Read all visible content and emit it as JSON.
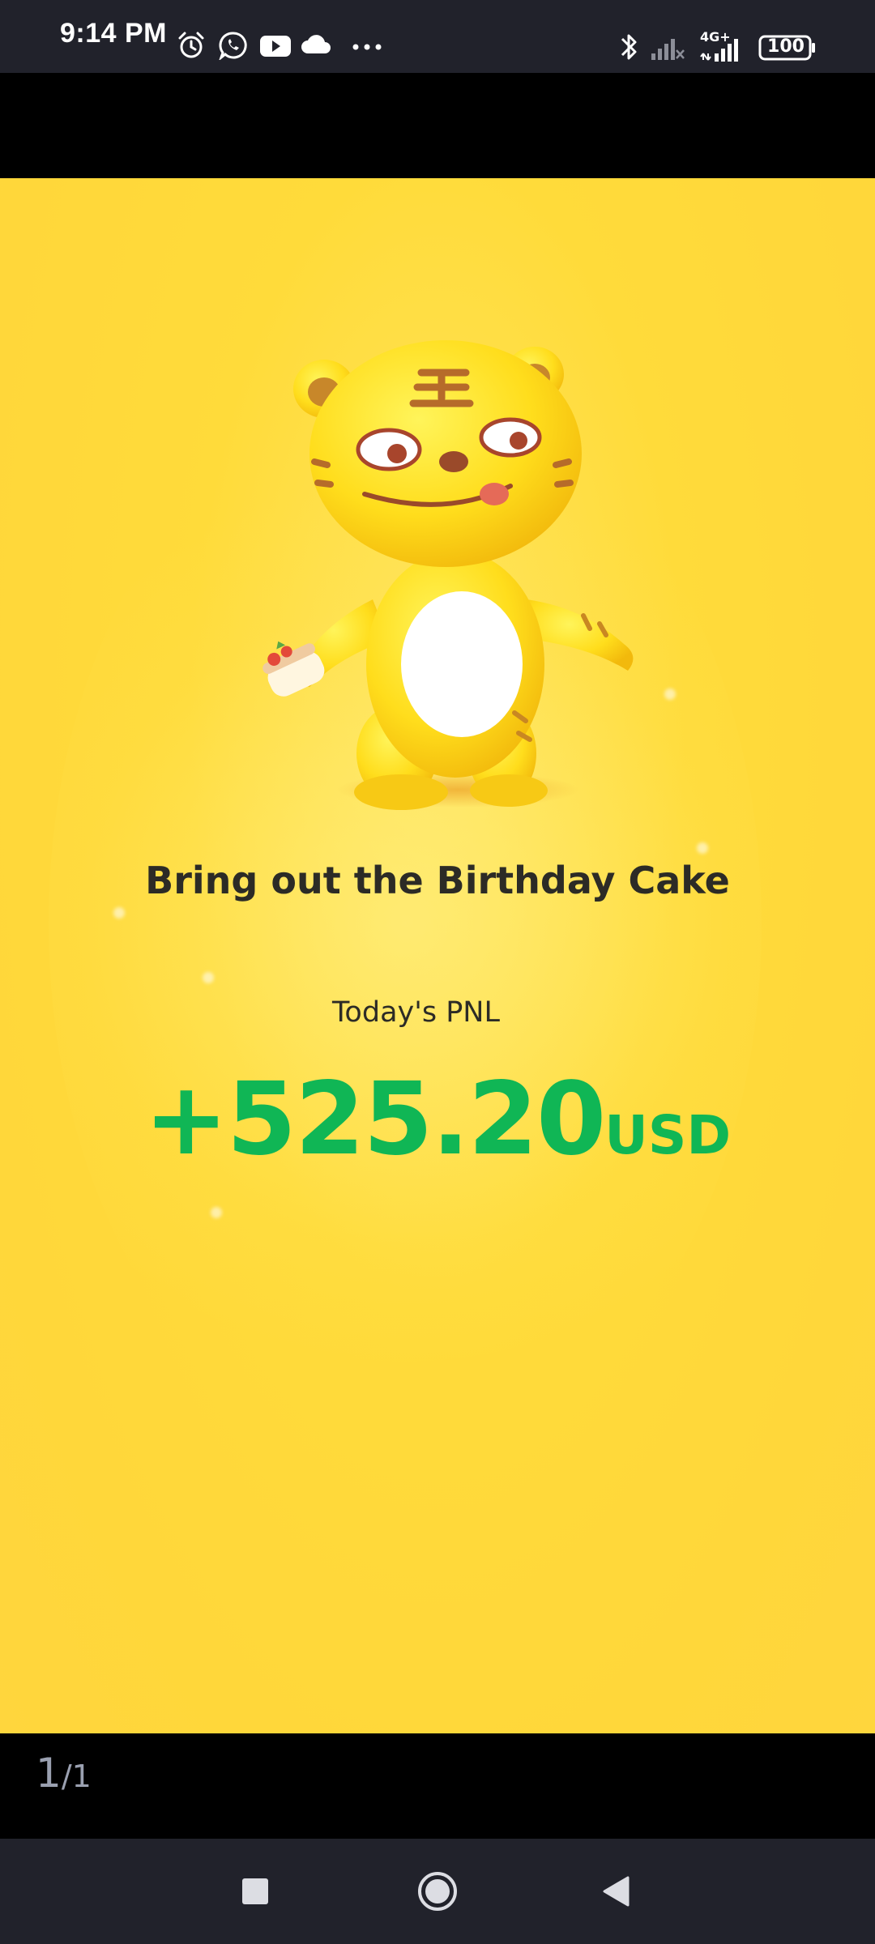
{
  "status_bar": {
    "time": "9:14 PM",
    "left_icons": [
      "alarm-icon",
      "whatsapp-icon",
      "youtube-icon",
      "cloud-icon",
      "more-dots-icon"
    ],
    "right_icons": [
      "bluetooth-icon",
      "signal-sim1-icon",
      "signal-4g-icon",
      "battery-icon"
    ],
    "network_label": "4G+",
    "battery_level": "100"
  },
  "card": {
    "headline": "Bring out the Birthday Cake",
    "pnl_label": "Today's PNL",
    "pnl_amount": "+525.20",
    "pnl_currency": "USD",
    "accent_color": "#10b655",
    "background_color": "#ffd73a"
  },
  "viewer": {
    "current_page": "1",
    "total_pages": "/1"
  },
  "nav_bar": {
    "buttons": [
      "recents-button",
      "home-button",
      "back-button"
    ]
  }
}
